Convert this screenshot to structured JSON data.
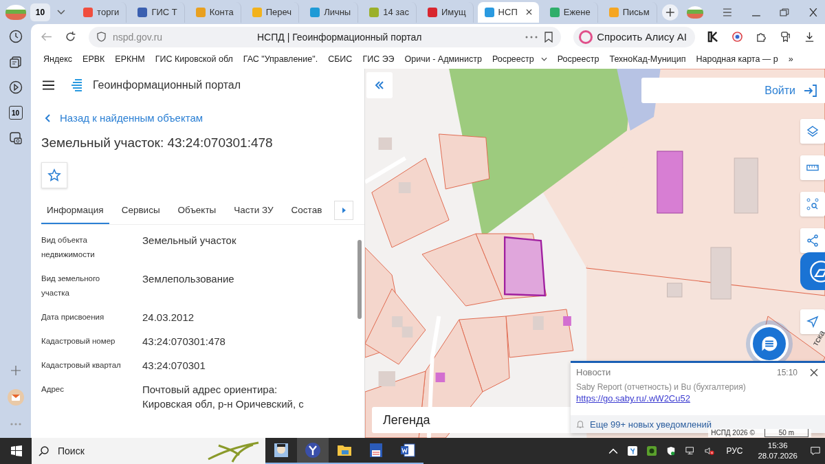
{
  "browser": {
    "tab_count": "10",
    "tabs": [
      {
        "label": "торги",
        "color": "#f04e3e",
        "selected": false
      },
      {
        "label": "ГИС Т",
        "color": "#3a5fb0",
        "selected": false
      },
      {
        "label": "Конта",
        "color": "#e8a020",
        "selected": false
      },
      {
        "label": "Переч",
        "color": "#f2b21c",
        "selected": false
      },
      {
        "label": "Личны",
        "color": "#1e9ad6",
        "selected": false
      },
      {
        "label": "14 зас",
        "color": "#9bb02a",
        "selected": false
      },
      {
        "label": "Имущ",
        "color": "#d8262f",
        "selected": false
      },
      {
        "label": "НСП",
        "color": "#2a9ae0",
        "selected": true
      },
      {
        "label": "Ежене",
        "color": "#2fae6a",
        "selected": false
      },
      {
        "label": "Письм",
        "color": "#f5a623",
        "selected": false
      }
    ],
    "url": "nspd.gov.ru",
    "page_title": "НСПД | Геоинформационный портал",
    "ask_button": "Спросить Алису AI",
    "sidebar_counter": "10",
    "bookmarks": [
      {
        "label": "Яндекс",
        "dropdown": false
      },
      {
        "label": "ЕРВК",
        "dropdown": false
      },
      {
        "label": "ЕРКНМ",
        "dropdown": false
      },
      {
        "label": "ГИС Кировской обл",
        "dropdown": false
      },
      {
        "label": "ГАС \"Управление\".",
        "dropdown": false
      },
      {
        "label": "СБИС",
        "dropdown": false
      },
      {
        "label": "ГИС ЭЭ",
        "dropdown": false
      },
      {
        "label": "Оричи - Администр",
        "dropdown": false
      },
      {
        "label": "Росреестр",
        "dropdown": true
      },
      {
        "label": "Росреестр",
        "dropdown": false
      },
      {
        "label": "ТехноКад-Муницип",
        "dropdown": false
      },
      {
        "label": "Народная карта — р",
        "dropdown": false
      }
    ],
    "bookmarks_more": "»"
  },
  "portal": {
    "title": "Геоинформационный портал",
    "back_link": "Назад к найденным объектам",
    "object_title": "Земельный участок: 43:24:070301:478",
    "tabs": [
      {
        "label": "Информация",
        "selected": true
      },
      {
        "label": "Сервисы",
        "selected": false
      },
      {
        "label": "Объекты",
        "selected": false
      },
      {
        "label": "Части ЗУ",
        "selected": false
      },
      {
        "label": "Состав",
        "selected": false
      }
    ],
    "fields": [
      {
        "label": "Вид объекта недвижимости",
        "value": "Земельный участок"
      },
      {
        "label": "Вид земельного участка",
        "value": "Землепользование"
      },
      {
        "label": "Дата присвоения",
        "value": "24.03.2012"
      },
      {
        "label": "Кадастровый номер",
        "value": "43:24:070301:478"
      },
      {
        "label": "Кадастровый квартал",
        "value": "43:24:070301"
      },
      {
        "label": "Адрес",
        "value": "Почтовый адрес ориентира: Кировская обл, р-н Оричевский, с"
      }
    ]
  },
  "map": {
    "login": "Войти",
    "legend": "Легенда",
    "street_label": "тска",
    "copyright": "НСПД 2026 ©",
    "scale": "50 m"
  },
  "notification": {
    "source": "Новости",
    "time": "15:10",
    "text": "Saby Report (отчетность) и Bu (бухгалтерия)",
    "link": "https://go.saby.ru/.wW2Cu52",
    "more": "Еще 99+ новых уведомлений"
  },
  "taskbar": {
    "search_placeholder": "Поиск",
    "language": "РУС",
    "time": "15:36",
    "date": "28.07.2026"
  }
}
